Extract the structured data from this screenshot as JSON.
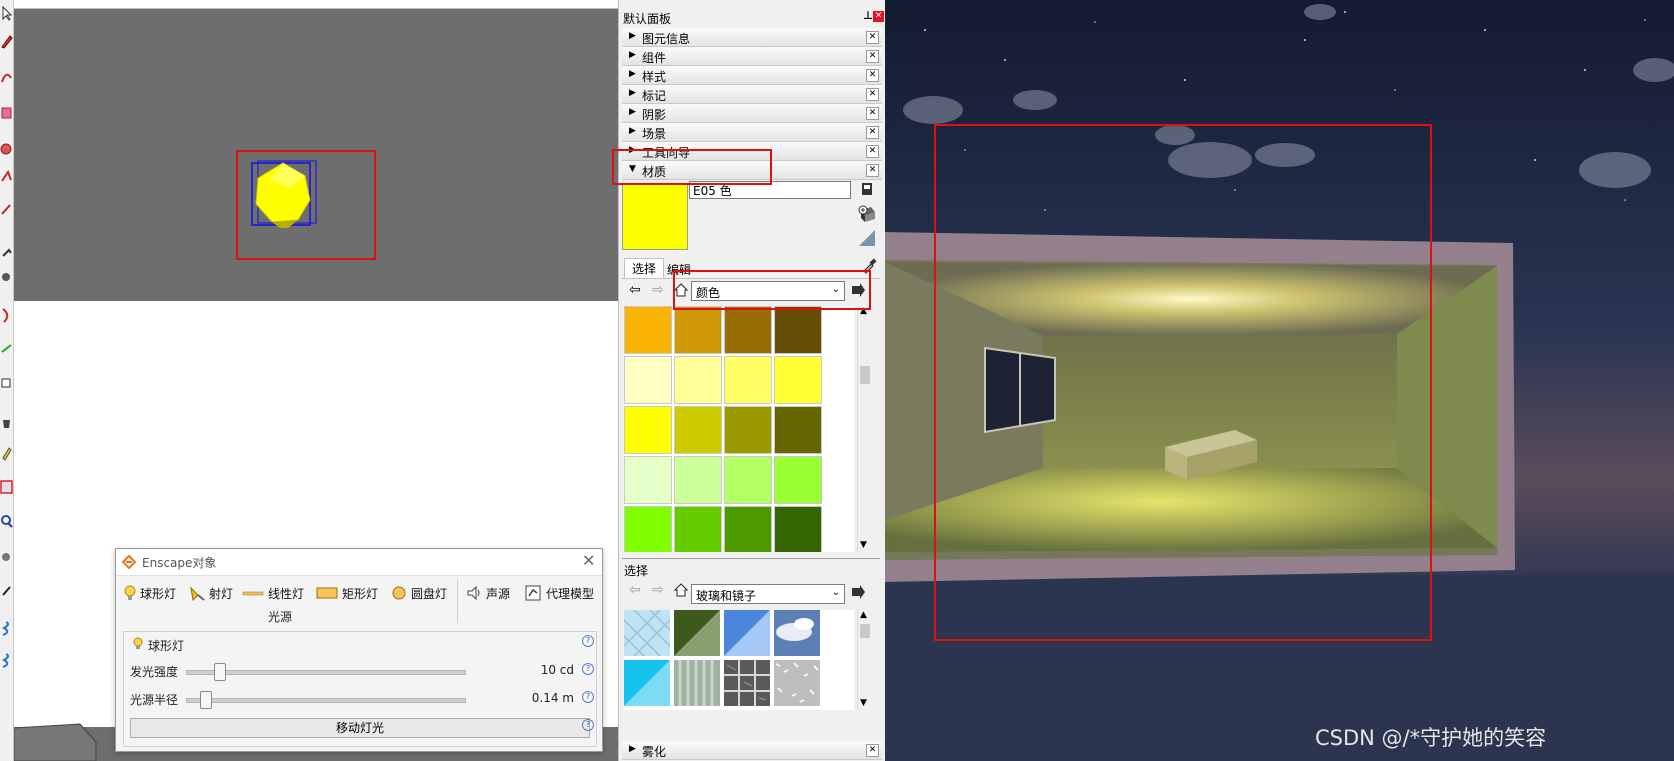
{
  "panel": {
    "title": "默认面板",
    "pin": "ᵖ",
    "trays": [
      {
        "label": "图元信息",
        "expanded": false
      },
      {
        "label": "组件",
        "expanded": false
      },
      {
        "label": "样式",
        "expanded": false
      },
      {
        "label": "标记",
        "expanded": false
      },
      {
        "label": "阴影",
        "expanded": false
      },
      {
        "label": "场景",
        "expanded": false
      },
      {
        "label": "工具向导",
        "expanded": false
      },
      {
        "label": "材质",
        "expanded": true
      }
    ],
    "material": {
      "name_value": "E05 色",
      "current_color": "#ffff00",
      "tab_select": "选择",
      "tab_edit": "编辑",
      "library_select": "颜色",
      "swatch_rows": [
        [
          "#f9b406",
          "#cf9806",
          "#996c06",
          "#654d05"
        ],
        [
          "#ffffc4",
          "#ffff99",
          "#ffff66",
          "#ffff33"
        ],
        [
          "#ffff00",
          "#cccc00",
          "#999900",
          "#666600"
        ],
        [
          "#e5ffc8",
          "#ccff99",
          "#b2ff66",
          "#99ff33"
        ],
        [
          "#80ff00",
          "#66cc00",
          "#4d9900",
          "#336600"
        ]
      ]
    },
    "secondary": {
      "tab_select": "选择",
      "library_select": "玻璃和镜子"
    },
    "bottom_tray": {
      "label": "雾化"
    }
  },
  "enscape": {
    "title": "Enscape对象",
    "tools": [
      "球形灯",
      "射灯",
      "线性灯",
      "矩形灯",
      "圆盘灯",
      "声源",
      "代理模型"
    ],
    "group_caption": "光源",
    "section_title": "球形灯",
    "intensity_label": "发光强度",
    "intensity_value": "10 cd",
    "intensity_fraction": 0.1,
    "radius_label": "光源半径",
    "radius_value": "0.14 m",
    "radius_fraction": 0.05,
    "move_button": "移动灯光"
  },
  "watermark": "CSDN @/*守护她的笑容",
  "colors": {
    "highlight_red": "#e01010",
    "selection_blue": "#1010e0"
  }
}
